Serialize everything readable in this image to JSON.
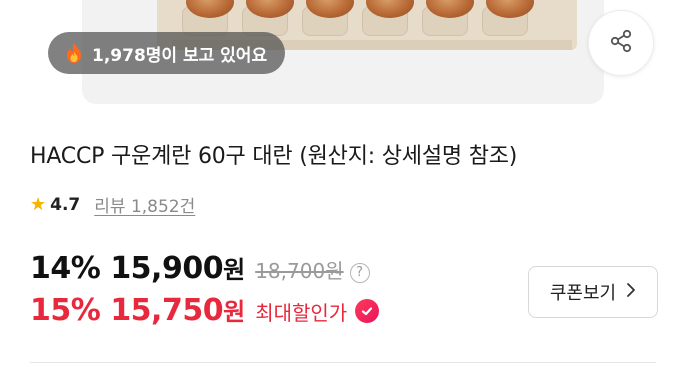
{
  "image": {
    "views_badge": "1,978명이 보고 있어요"
  },
  "product": {
    "title": "HACCP 구운계란 60구 대란 (원산지: 상세설명 참조)",
    "rating": "4.7",
    "review_label": "리뷰 1,852건"
  },
  "pricing": {
    "row1": {
      "discount": "14%",
      "price": "15,900",
      "currency": "원",
      "original_price": "18,700원"
    },
    "row2": {
      "discount": "15%",
      "price": "15,750",
      "currency": "원",
      "label": "최대할인가"
    }
  },
  "coupon": {
    "label": "쿠폰보기"
  },
  "icons": {
    "fire": "fire-icon",
    "share": "share-icon",
    "star": "star-icon",
    "help": "help-icon",
    "check": "check-badge-icon",
    "chevron": "chevron-right-icon"
  },
  "colors": {
    "discount_red": "#e8283c",
    "star": "#f5b400"
  }
}
